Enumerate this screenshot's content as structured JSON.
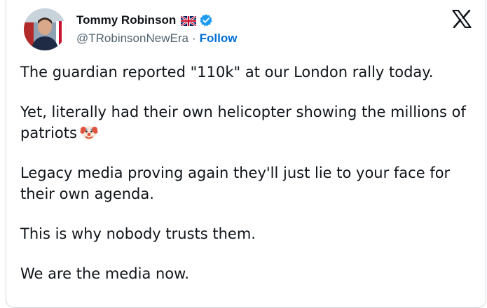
{
  "author": {
    "display_name": "Tommy Robinson",
    "handle": "@TRobinsonNewEra",
    "separator": "·",
    "follow_label": "Follow",
    "flag_icon": "uk-flag-icon",
    "verified_icon": "verified-badge-icon",
    "verified_color": "#1d9bf0"
  },
  "platform_icon": "x-logo-icon",
  "tweet": {
    "p1": "The guardian reported \"110k\" at our London rally today.",
    "p2_a": "Yet, literally had their own helicopter showing the millions of patriots",
    "p2_emoji": "clown-face-icon",
    "p3": "Legacy media proving again they'll just lie to your face for their own agenda.",
    "p4": "This is why nobody trusts them.",
    "p5": "We are the media now."
  },
  "colors": {
    "text": "#0f1419",
    "muted": "#536471",
    "link": "#006fd6",
    "border": "#cfd9de"
  }
}
